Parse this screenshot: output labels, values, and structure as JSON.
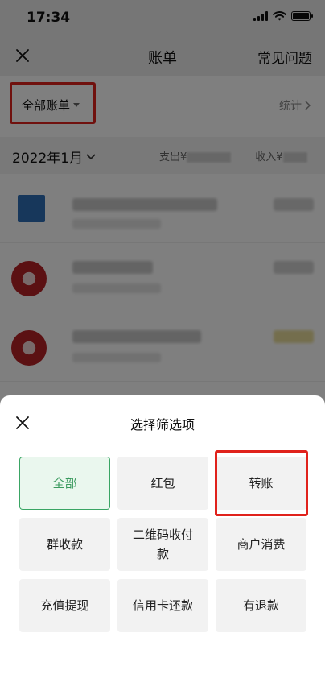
{
  "status_bar": {
    "time": "17:34"
  },
  "nav": {
    "title": "账单",
    "faq_label": "常见问题"
  },
  "filter": {
    "all_bills_label": "全部账单",
    "stats_label": "统计"
  },
  "month_row": {
    "month_label": "2022年1月",
    "expense_label": "支出¥",
    "income_label": "收入¥"
  },
  "sheet": {
    "title": "选择筛选项",
    "options": [
      {
        "label": "全部",
        "selected": true
      },
      {
        "label": "红包",
        "selected": false
      },
      {
        "label": "转账",
        "selected": false
      },
      {
        "label": "群收款",
        "selected": false
      },
      {
        "label": "二维码收付款",
        "selected": false
      },
      {
        "label": "商户消费",
        "selected": false
      },
      {
        "label": "充值提现",
        "selected": false
      },
      {
        "label": "信用卡还款",
        "selected": false
      },
      {
        "label": "有退款",
        "selected": false
      }
    ]
  },
  "colors": {
    "accent_green": "#3aa564",
    "highlight_red": "#e0221c",
    "selected_bg": "#eaf7ee"
  },
  "icons": [
    "close-icon",
    "caret-down-icon",
    "chevron-right-icon",
    "chevron-down-icon",
    "signal-icon",
    "wifi-icon",
    "battery-icon"
  ]
}
